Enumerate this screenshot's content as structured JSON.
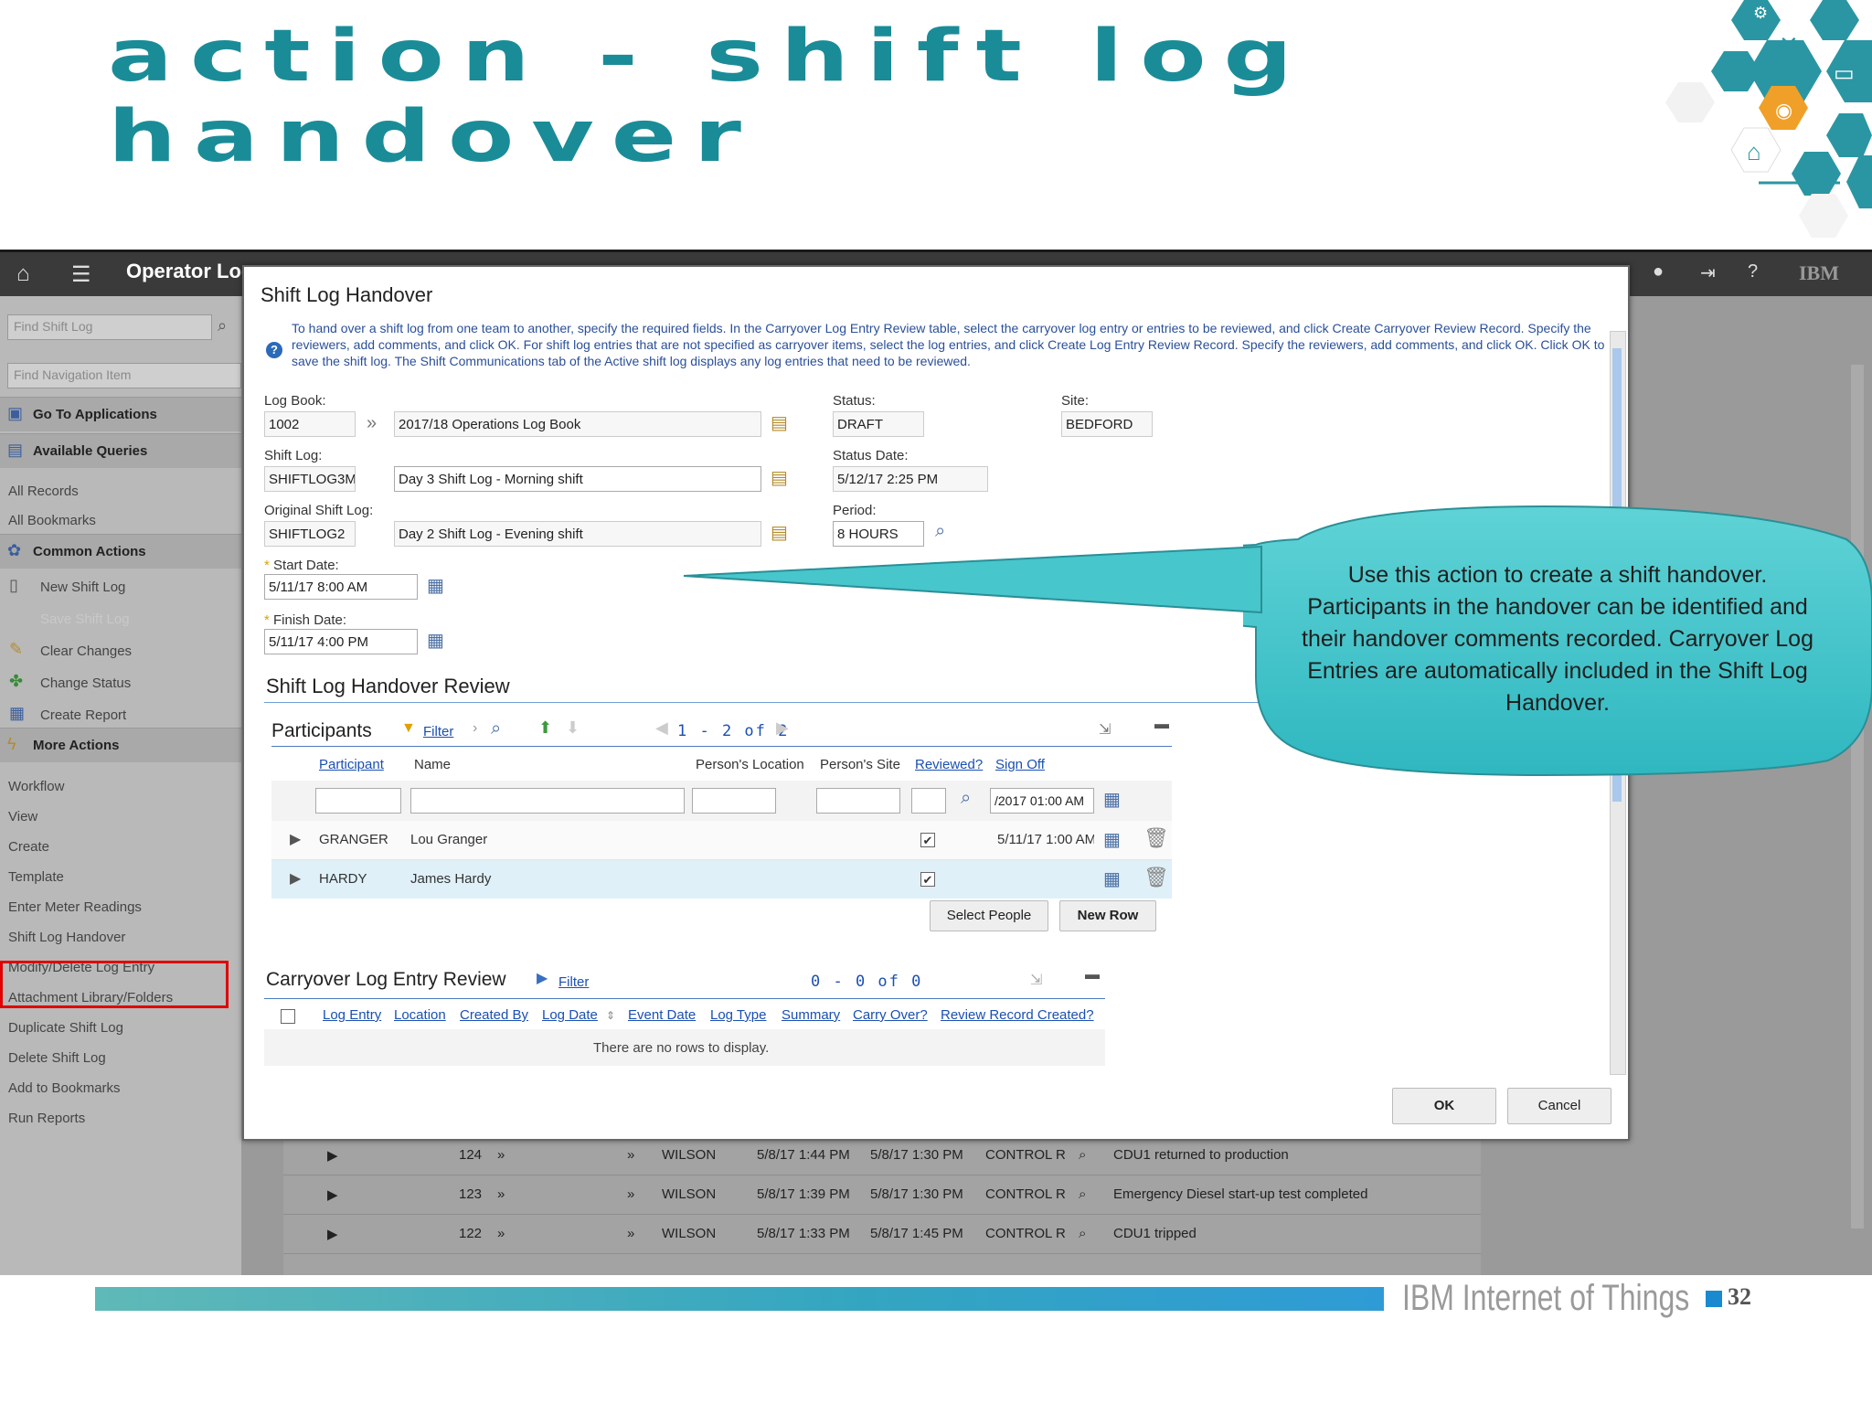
{
  "slide": {
    "title_line1": "action - shift log",
    "title_line2": "handover",
    "footer_brand": "IBM Internet of Things",
    "page_number": "32"
  },
  "app": {
    "title": "Operator Log",
    "brand_logo": "IBM",
    "icons": [
      "home-icon",
      "menu-icon",
      "user-icon",
      "logout-icon",
      "help-icon"
    ]
  },
  "sidebar": {
    "find_shift_log_placeholder": "Find Shift Log",
    "find_nav_placeholder": "Find Navigation Item",
    "go_to_applications": "Go To Applications",
    "available_queries": "Available Queries",
    "queries": [
      "All Records",
      "All Bookmarks"
    ],
    "common_actions": "Common Actions",
    "common_items": [
      "New Shift Log",
      "Save Shift Log",
      "Clear Changes",
      "Change Status",
      "Create Report"
    ],
    "more_actions": "More Actions",
    "more_items": [
      "Workflow",
      "View",
      "Create",
      "Template",
      "Enter Meter Readings",
      "Shift Log Handover",
      "Modify/Delete Log Entry",
      "Attachment Library/Folders",
      "Duplicate Shift Log",
      "Delete Shift Log",
      "Add to Bookmarks",
      "Run Reports"
    ]
  },
  "background_rows": [
    {
      "id": "124",
      "user": "WILSON",
      "date1": "5/8/17 1:44 PM",
      "date2": "5/8/17 1:30 PM",
      "loc": "CONTROL R",
      "summary": "CDU1 returned to production"
    },
    {
      "id": "123",
      "user": "WILSON",
      "date1": "5/8/17 1:39 PM",
      "date2": "5/8/17 1:30 PM",
      "loc": "CONTROL R",
      "summary": "Emergency Diesel start-up test completed"
    },
    {
      "id": "122",
      "user": "WILSON",
      "date1": "5/8/17 1:33 PM",
      "date2": "5/8/17 1:45 PM",
      "loc": "CONTROL R",
      "summary": "CDU1 tripped"
    }
  ],
  "dialog": {
    "title": "Shift Log Handover",
    "help_text": "To hand over a shift log from one team to another, specify the required fields. In the Carryover Log Entry Review table, select the carryover log entry or entries to be reviewed, and click Create Carryover Review Record. Specify the reviewers, add comments, and click OK. For shift log entries that are not specified as carryover items, select the log entries, and click Create Log Entry Review Record. Specify the reviewers, add comments, and click OK. Click OK to save the shift log. The Shift Communications tab of the Active shift log displays any log entries that need to be reviewed.",
    "log_book_label": "Log Book:",
    "log_book_id": "1002",
    "log_book_desc": "2017/18 Operations Log Book",
    "status_label": "Status:",
    "status": "DRAFT",
    "site_label": "Site:",
    "site": "BEDFORD",
    "shift_log_label": "Shift Log:",
    "shift_log_id": "SHIFTLOG3M",
    "shift_log_desc": "Day 3 Shift Log - Morning shift",
    "status_date_label": "Status Date:",
    "status_date": "5/12/17 2:25 PM",
    "orig_shift_log_label": "Original Shift Log:",
    "orig_shift_log_id": "SHIFTLOG2",
    "orig_shift_log_desc": "Day 2 Shift Log - Evening shift",
    "period_label": "Period:",
    "period": "8 HOURS",
    "start_date_label": "Start Date:",
    "start_date": "5/11/17 8:00 AM",
    "finish_date_label": "Finish Date:",
    "finish_date": "5/11/17 4:00 PM",
    "review_section": "Shift Log Handover Review",
    "participants_title": "Participants",
    "filter_label": "Filter",
    "participants_pager": "1 - 2 of 2",
    "participant_headers": [
      "Participant",
      "Name",
      "Person's Location",
      "Person's Site",
      "Reviewed?",
      "Sign Off"
    ],
    "sign_off_filter": "/2017 01:00 AM",
    "participants": [
      {
        "id": "GRANGER",
        "name": "Lou Granger",
        "reviewed": "✔",
        "sign_off": "5/11/17 1:00 AM"
      },
      {
        "id": "HARDY",
        "name": "James Hardy",
        "reviewed": "✔",
        "sign_off": ""
      }
    ],
    "select_people": "Select People",
    "new_row": "New Row",
    "carryover_title": "Carryover Log Entry Review",
    "carryover_pager": "0 - 0 of 0",
    "carryover_headers": [
      "Log Entry",
      "Location",
      "Created By",
      "Log Date",
      "Event Date",
      "Log Type",
      "Summary",
      "Carry Over?",
      "Review Record Created?"
    ],
    "no_rows": "There are no rows to display.",
    "ok": "OK",
    "cancel": "Cancel"
  },
  "callout": {
    "text": "Use this action to create a shift handover. Participants in the handover can be identified and their handover comments recorded. Carryover Log Entries are automatically included in the Shift Log Handover."
  },
  "colors": {
    "title_teal": "#1a8c98",
    "callout_fill": "#47c6cc",
    "highlight_red": "#e00000",
    "link_blue": "#1a4fb3"
  }
}
